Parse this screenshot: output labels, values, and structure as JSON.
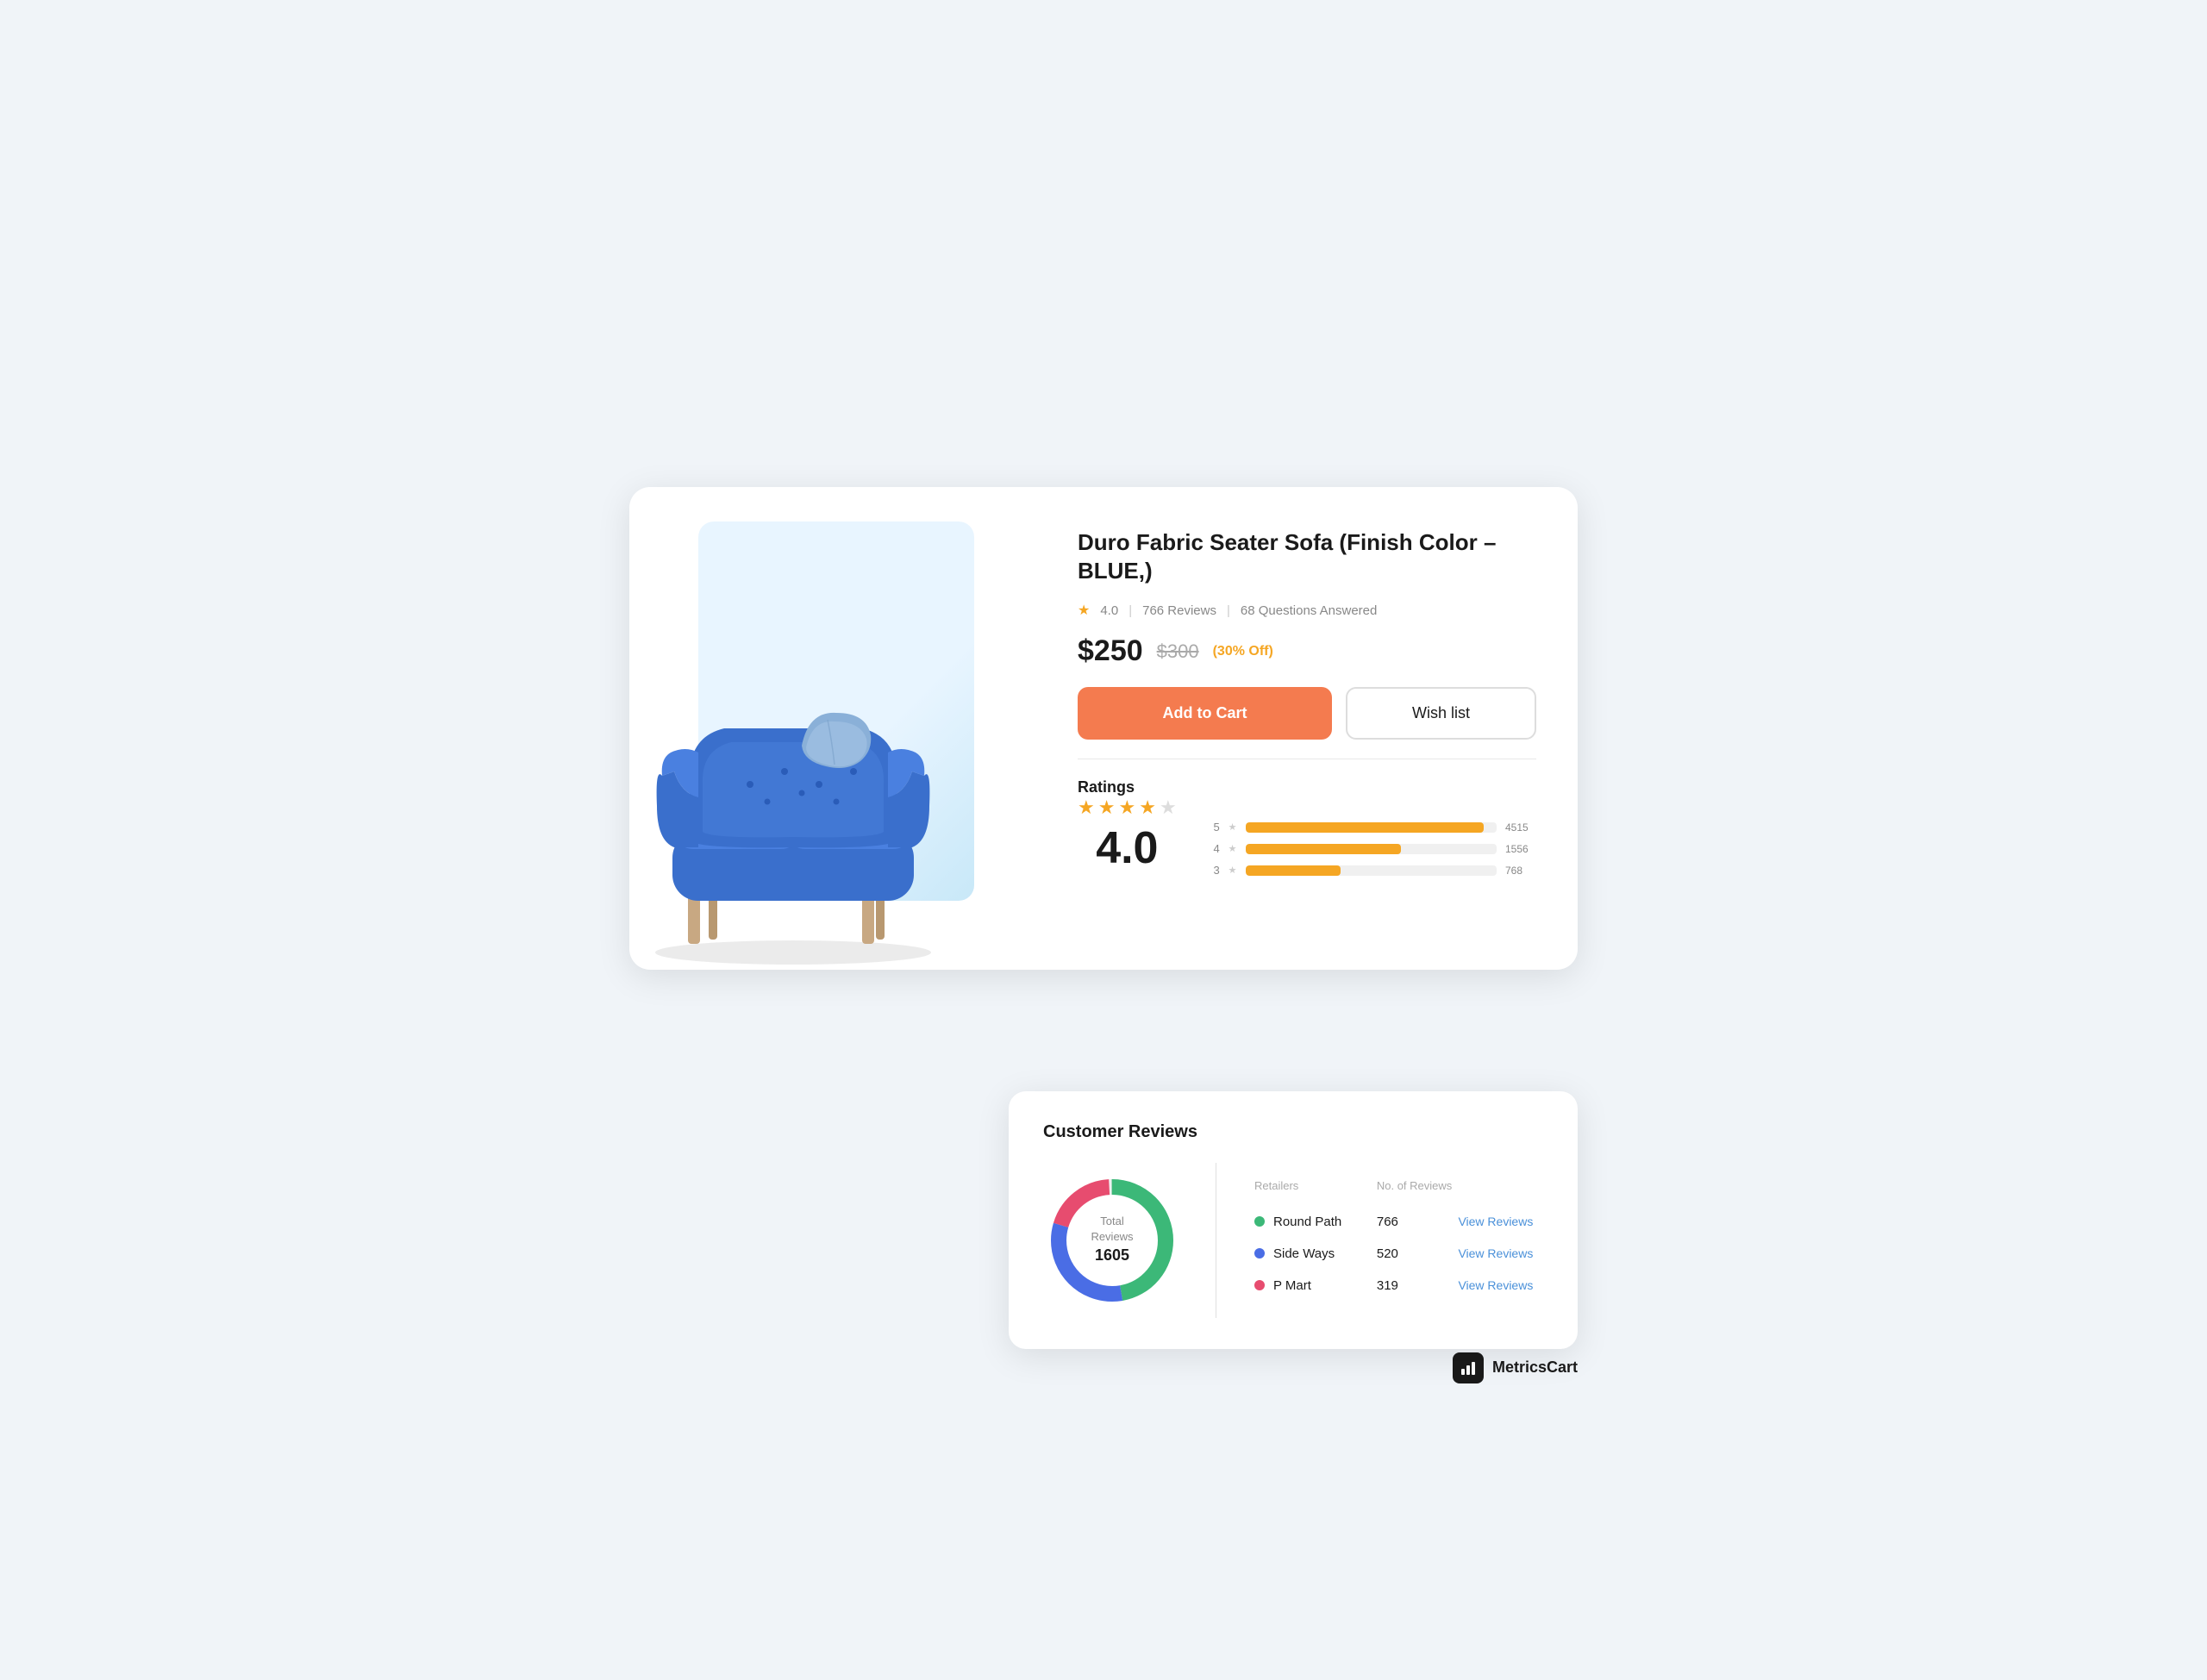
{
  "product": {
    "title": "Duro Fabric Seater Sofa  (Finish Color – BLUE,)",
    "rating": "4.0",
    "reviews_count": "766 Reviews",
    "questions": "68 Questions Answered",
    "price_current": "$250",
    "price_original": "$300",
    "price_discount": "(30% Off)",
    "btn_add_cart": "Add to Cart",
    "btn_wishlist": "Wish list"
  },
  "ratings": {
    "title": "Ratings",
    "big_number": "4.0",
    "bars": [
      {
        "label": "5",
        "count": "4515",
        "pct": 95
      },
      {
        "label": "4",
        "count": "1556",
        "pct": 62
      },
      {
        "label": "3",
        "count": "768",
        "pct": 38
      }
    ]
  },
  "reviews_card": {
    "title": "Customer Reviews",
    "donut_center_line1": "Total",
    "donut_center_line2": "Reviews",
    "donut_center_number": "1605",
    "col_retailers": "Retailers",
    "col_no_reviews": "No. of Reviews",
    "rows": [
      {
        "name": "Round Path",
        "count": "766",
        "dot_color": "#3cb878",
        "action": "View Reviews"
      },
      {
        "name": "Side Ways",
        "count": "520",
        "dot_color": "#4a6de5",
        "action": "View Reviews"
      },
      {
        "name": "P Mart",
        "count": "319",
        "dot_color": "#e74c6f",
        "action": "View Reviews"
      }
    ]
  },
  "brand": {
    "name": "MetricsCart",
    "icon": "📊"
  }
}
